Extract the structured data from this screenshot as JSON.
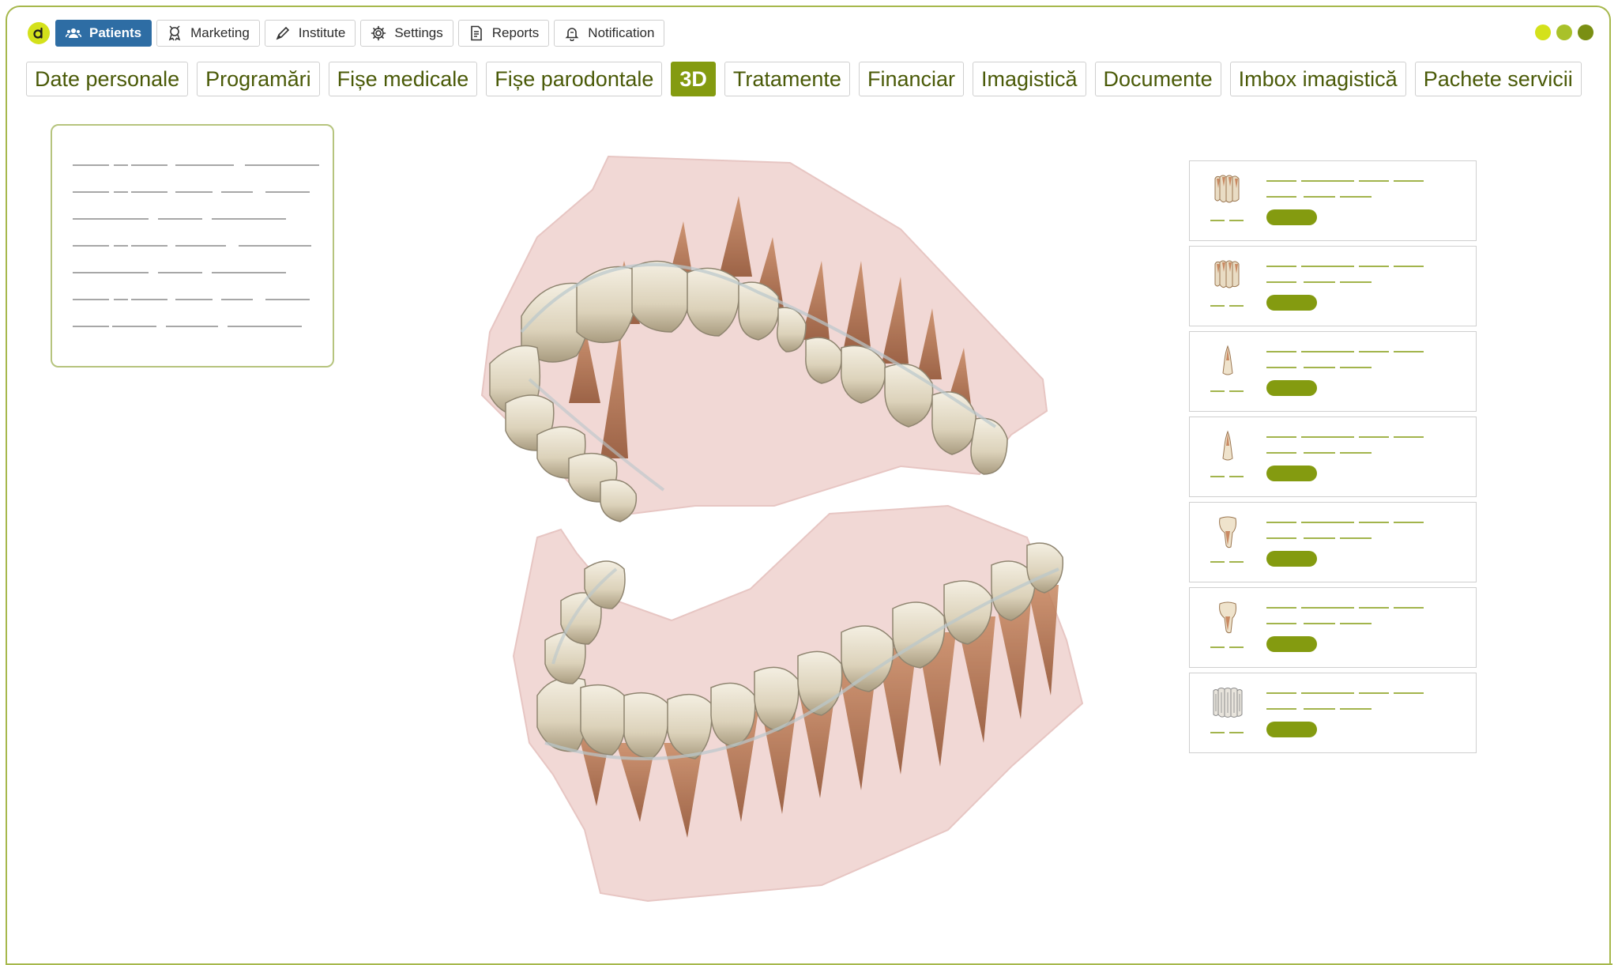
{
  "app": {
    "logo_letter": "d",
    "accent_color": "#849b10",
    "nav_blue": "#2e6da4"
  },
  "top_nav": [
    {
      "label": "Patients",
      "icon": "users-icon",
      "active": true
    },
    {
      "label": "Marketing",
      "icon": "award-icon",
      "active": false
    },
    {
      "label": "Institute",
      "icon": "pen-icon",
      "active": false
    },
    {
      "label": "Settings",
      "icon": "gear-icon",
      "active": false
    },
    {
      "label": "Reports",
      "icon": "document-icon",
      "active": false
    },
    {
      "label": "Notification",
      "icon": "bell-icon",
      "active": false
    }
  ],
  "window_dots": [
    "#d4e11b",
    "#a9c12a",
    "#7a8f13"
  ],
  "tabs": [
    {
      "label": "Date personale",
      "active": false
    },
    {
      "label": "Programări",
      "active": false
    },
    {
      "label": "Fișe medicale",
      "active": false
    },
    {
      "label": "Fișe parodontale",
      "active": false
    },
    {
      "label": "3D",
      "active": true
    },
    {
      "label": "Tratamente",
      "active": false
    },
    {
      "label": "Financiar",
      "active": false
    },
    {
      "label": "Imagistică",
      "active": false
    },
    {
      "label": "Documente",
      "active": false
    },
    {
      "label": "Imbox imagistică",
      "active": false
    },
    {
      "label": "Pachete servicii",
      "active": false
    }
  ],
  "tooth_list": [
    {
      "thumbnail": "molar-group-icon"
    },
    {
      "thumbnail": "molar-group-icon"
    },
    {
      "thumbnail": "incisor-icon"
    },
    {
      "thumbnail": "incisor-icon"
    },
    {
      "thumbnail": "molar-icon"
    },
    {
      "thumbnail": "molar-icon"
    },
    {
      "thumbnail": "tooth-row-icon"
    }
  ]
}
